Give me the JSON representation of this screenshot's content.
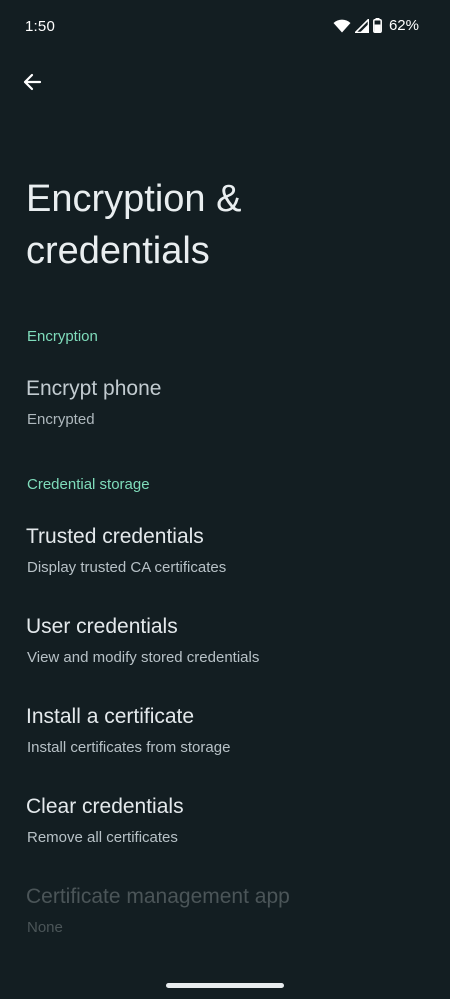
{
  "status_bar": {
    "time": "1:50",
    "battery_percent": "62%",
    "icons": [
      "wifi-icon",
      "cellular-signal-icon",
      "battery-icon"
    ]
  },
  "toolbar": {
    "back_icon": "arrow-left-icon"
  },
  "page": {
    "title": "Encryption & credentials"
  },
  "sections": [
    {
      "header": "Encryption",
      "items": [
        {
          "title": "Encrypt phone",
          "summary": "Encrypted",
          "enabled": true
        }
      ]
    },
    {
      "header": "Credential storage",
      "items": [
        {
          "title": "Trusted credentials",
          "summary": "Display trusted CA certificates",
          "enabled": true
        },
        {
          "title": "User credentials",
          "summary": "View and modify stored credentials",
          "enabled": true
        },
        {
          "title": "Install a certificate",
          "summary": "Install certificates from storage",
          "enabled": true
        },
        {
          "title": "Clear credentials",
          "summary": "Remove all certificates",
          "enabled": true
        },
        {
          "title": "Certificate management app",
          "summary": "None",
          "enabled": false
        }
      ]
    }
  ],
  "colors": {
    "background": "#131e22",
    "accent": "#7fdcbb",
    "title_text": "#e4e9ec",
    "summary_text": "#b7c1c6",
    "disabled_text": "#4b5558"
  }
}
